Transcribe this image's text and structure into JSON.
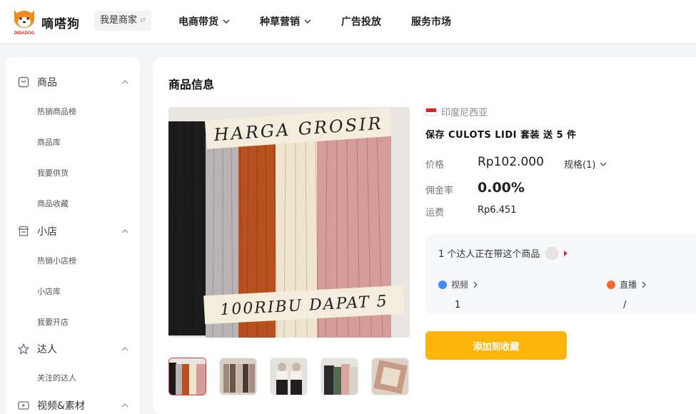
{
  "header": {
    "brand": "嘀嗒狗",
    "logo_text": "DIDADOG",
    "merchant_switch": "我是商家",
    "merchant_switch_icon": "swap-icon",
    "nav": [
      {
        "label": "电商带货",
        "has_dropdown": true
      },
      {
        "label": "种草营销",
        "has_dropdown": true
      },
      {
        "label": "广告投放",
        "has_dropdown": false
      },
      {
        "label": "服务市场",
        "has_dropdown": false
      }
    ]
  },
  "sidebar": {
    "groups": [
      {
        "label": "商品",
        "icon": "bag-icon",
        "items": [
          "热销商品榜",
          "商品库",
          "我要供货",
          "商品收藏"
        ]
      },
      {
        "label": "小店",
        "icon": "store-icon",
        "items": [
          "热销小店榜",
          "小店库",
          "我要开店"
        ]
      },
      {
        "label": "达人",
        "icon": "star-icon",
        "items": [
          "关注的达人"
        ]
      },
      {
        "label": "视频&素材",
        "icon": "video-icon",
        "items": []
      }
    ]
  },
  "product": {
    "section_title": "商品信息",
    "country": "印度尼西亚",
    "title": "保存 CULOTS LIDI 套装 送 5 件",
    "image_text_top": "HARGA GROSIR",
    "image_text_bottom": "100RIBU DAPAT 5",
    "price_label": "价格",
    "price": "Rp102.000",
    "spec": "规格(1)",
    "commission_label": "佣金率",
    "commission": "0.00%",
    "shipping_label": "运费",
    "shipping": "Rp6.451",
    "kol": {
      "headline": "1 个达人正在带这个商品",
      "video_label": "视频",
      "video_value": "1",
      "live_label": "直播",
      "live_value": "/"
    },
    "add_button": "添加到收藏"
  },
  "colors": {
    "accent": "#fdb40b",
    "active_thumb_border": "#d93a3a",
    "video_dot": "#3d8bfd",
    "live_dot": "#fb6a2c"
  }
}
